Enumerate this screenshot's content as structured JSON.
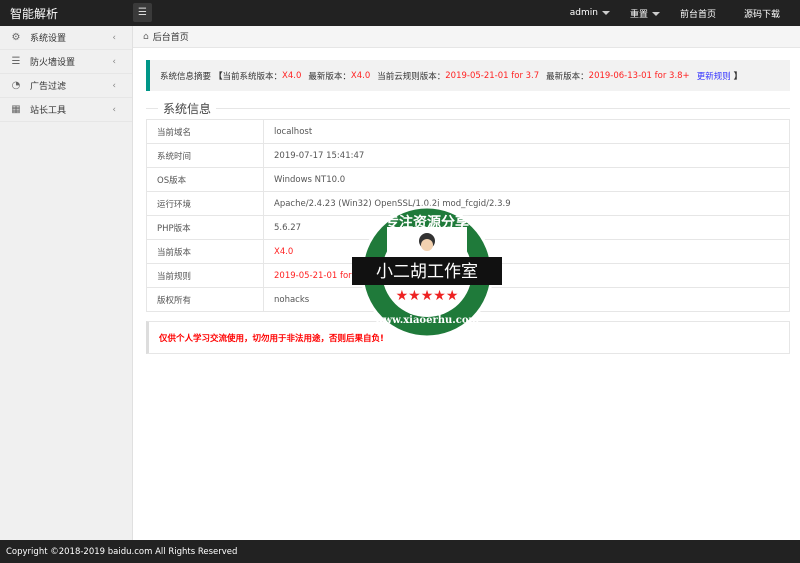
{
  "header": {
    "logo": "智能解析",
    "user": "admin",
    "reset": "重置",
    "frontend": "前台首页",
    "source": "源码下载"
  },
  "sidebar": {
    "items": [
      {
        "label": "系统设置",
        "icon": "gear-icon"
      },
      {
        "label": "防火墙设置",
        "icon": "list-icon"
      },
      {
        "label": "广告过滤",
        "icon": "chart-icon"
      },
      {
        "label": "站长工具",
        "icon": "grid-icon"
      }
    ]
  },
  "breadcrumb": {
    "home": "后台首页"
  },
  "notice": {
    "title": "系统信息摘要",
    "open": "【",
    "cur_ver_label": "当前系统版本：",
    "cur_ver": "X4.0",
    "new_ver_label": "最新版本：",
    "new_ver": "X4.0",
    "cur_rule_label": "当前云规则版本：",
    "cur_rule": "2019-05-21-01 for 3.7",
    "new_rule_label": "最新版本：",
    "new_rule": "2019-06-13-01 for 3.8+",
    "update_link": "更新规则",
    "close": "】"
  },
  "sysinfo": {
    "title": "系统信息",
    "rows": [
      {
        "k": "当前域名",
        "v": "localhost"
      },
      {
        "k": "系统时间",
        "v": "2019-07-17 15:41:47"
      },
      {
        "k": "OS版本",
        "v": "Windows NT10.0"
      },
      {
        "k": "运行环境",
        "v": "Apache/2.4.23 (Win32) OpenSSL/1.0.2j mod_fcgid/2.3.9"
      },
      {
        "k": "PHP版本",
        "v": "5.6.27"
      },
      {
        "k": "当前版本",
        "v": "X4.0"
      },
      {
        "k": "当前规则",
        "v": "2019-05-21-01 for 3.7"
      },
      {
        "k": "版权所有",
        "v": "nohacks"
      }
    ]
  },
  "warning": "仅供个人学习交流使用，切勿用于非法用途，否则后果自负!",
  "footer": "Copyright ©2018-2019 baidu.com All Rights Reserved",
  "watermark": {
    "top": "专注资源分享",
    "center": "小二胡工作室",
    "bottom": "www.xiaoerhu.com"
  },
  "colors": {
    "accent": "#009688",
    "red": "#ff2222",
    "link": "#3333ff"
  }
}
